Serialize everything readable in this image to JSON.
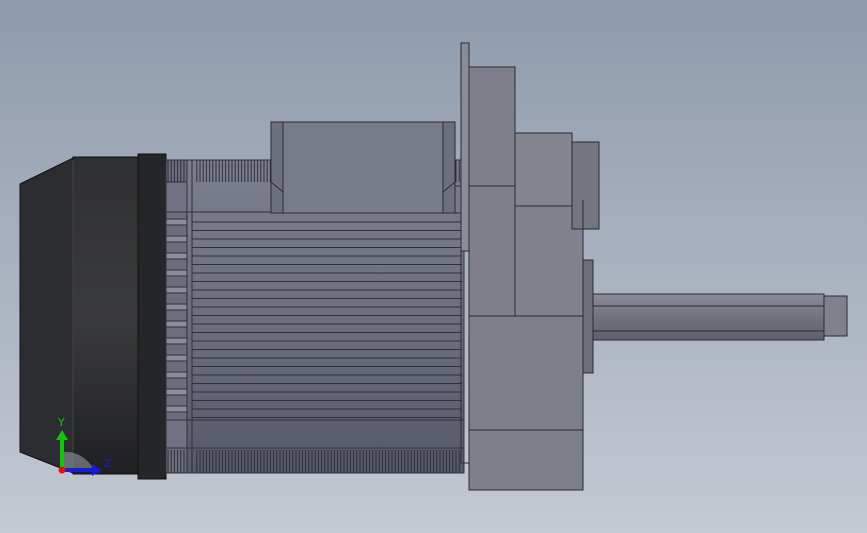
{
  "triad": {
    "y_label": "Y",
    "z_label": "Z",
    "y_color": "#17c20f",
    "z_color": "#1a1ad8",
    "x_color": "#e01010"
  },
  "colors": {
    "background_top": "#8e9aac",
    "background_bottom": "#c4c9d3",
    "fan_cover": "#2a2b2d",
    "motor_body": "#6e7180",
    "gearbox": "#7e808c",
    "shaft": "#7a7c88"
  }
}
